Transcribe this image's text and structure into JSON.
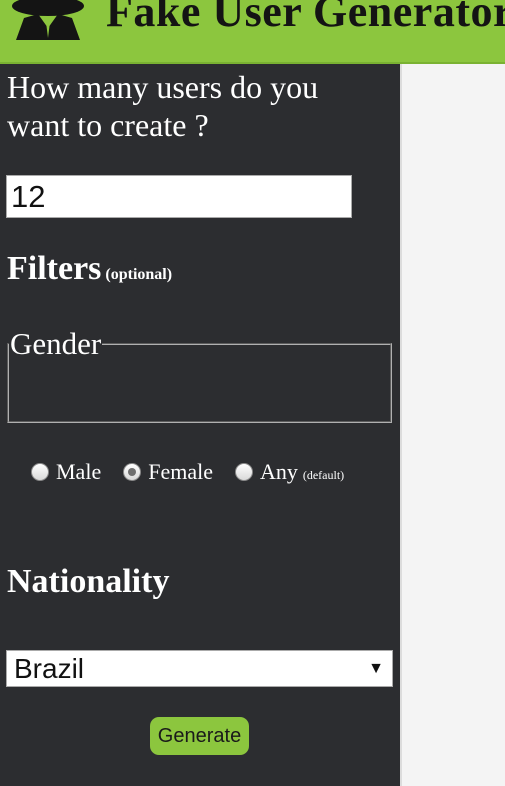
{
  "header": {
    "title": "Fake User Generator",
    "logo_icon": "spy-icon",
    "accent_color": "#8cc63e"
  },
  "form": {
    "question": "How many users do you want to create ?",
    "user_count": "12",
    "filters_heading": "Filters",
    "filters_note": "(optional)",
    "gender": {
      "legend": "Gender",
      "options": [
        {
          "label": "Male",
          "checked": false
        },
        {
          "label": "Female",
          "checked": true
        },
        {
          "label": "Any",
          "checked": false,
          "note": "(default)"
        }
      ]
    },
    "nationality_heading": "Nationality",
    "nationality_value": "Brazil",
    "generate_label": "Generate"
  }
}
